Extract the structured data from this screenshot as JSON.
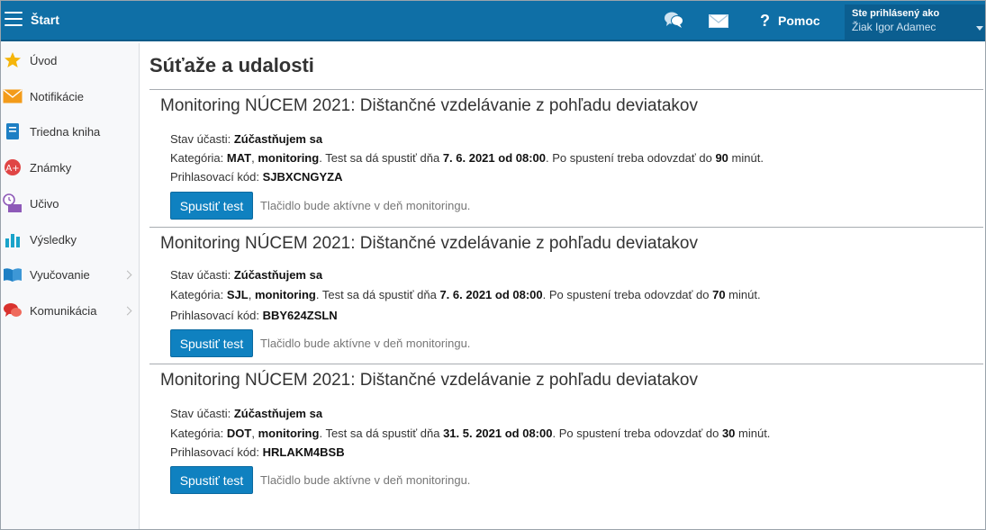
{
  "header": {
    "brand": "Štart",
    "help_label": "Pomoc",
    "help_symbol": "?",
    "user_top": "Ste prihlásený ako",
    "user_name": "Žiak Igor Adamec",
    "bar_color": "#0f6fa6"
  },
  "sidebar": {
    "items": [
      {
        "label": "Úvod",
        "icon": "star-icon",
        "color": "#f5b50a",
        "has_submenu": false
      },
      {
        "label": "Notifikácie",
        "icon": "envelope-icon",
        "color": "#f39b1a",
        "has_submenu": false
      },
      {
        "label": "Triedna kniha",
        "icon": "book-icon",
        "color": "#1e7fc4",
        "has_submenu": false
      },
      {
        "label": "Známky",
        "icon": "grade-icon",
        "color": "#e04545",
        "has_submenu": false
      },
      {
        "label": "Učivo",
        "icon": "clock-book-icon",
        "color": "#8e5ab8",
        "has_submenu": false
      },
      {
        "label": "Výsledky",
        "icon": "bar-chart-icon",
        "color": "#1aa3c9",
        "has_submenu": false
      },
      {
        "label": "Vyučovanie",
        "icon": "open-book-icon",
        "color": "#1e7fc4",
        "has_submenu": true
      },
      {
        "label": "Komunikácia",
        "icon": "chat-bubbles-icon",
        "color": "#d9322e",
        "has_submenu": true
      }
    ]
  },
  "main": {
    "page_title": "Súťaže a udalosti",
    "events": [
      {
        "title": "Monitoring NÚCEM 2021: Dištančné vzdelávanie z pohľadu deviatakov",
        "status_label": "Stav účasti: ",
        "status_value": "Zúčastňujem sa",
        "cat_label": "Kategória: ",
        "cat_subject": "MAT",
        "cat_sep": ", ",
        "cat_type": "monitoring",
        "cat_text1": ". Test sa dá spustiť dňa ",
        "cat_date": "7. 6. 2021 od 08:00",
        "cat_text2": ". Po spustení treba odovzdať do ",
        "cat_minutes": "90",
        "cat_text3": " minút.",
        "code_label": "Prihlasovací kód: ",
        "code_value": "SJBXCNGYZA",
        "button_label": "Spustiť test",
        "note": "Tlačidlo bude aktívne v deň monitoringu."
      },
      {
        "title": "Monitoring NÚCEM 2021: Dištančné vzdelávanie z pohľadu deviatakov",
        "status_label": "Stav účasti: ",
        "status_value": "Zúčastňujem sa",
        "cat_label": "Kategória: ",
        "cat_subject": "SJL",
        "cat_sep": ", ",
        "cat_type": "monitoring",
        "cat_text1": ". Test sa dá spustiť dňa ",
        "cat_date": "7. 6. 2021 od 08:00",
        "cat_text2": ". Po spustení treba odovzdať do ",
        "cat_minutes": "70",
        "cat_text3": " minút.",
        "code_label": "Prihlasovací kód: ",
        "code_value": "BBY624ZSLN",
        "button_label": "Spustiť test",
        "note": "Tlačidlo bude aktívne v deň monitoringu."
      },
      {
        "title": "Monitoring NÚCEM 2021: Dištančné vzdelávanie z pohľadu deviatakov",
        "status_label": "Stav účasti: ",
        "status_value": "Zúčastňujem sa",
        "cat_label": "Kategória: ",
        "cat_subject": "DOT",
        "cat_sep": ", ",
        "cat_type": "monitoring",
        "cat_text1": ". Test sa dá spustiť dňa ",
        "cat_date": "31. 5. 2021 od 08:00",
        "cat_text2": ". Po spustení treba odovzdať do ",
        "cat_minutes": "30",
        "cat_text3": " minút.",
        "code_label": "Prihlasovací kód: ",
        "code_value": "HRLAKM4BSB",
        "button_label": "Spustiť test",
        "note": "Tlačidlo bude aktívne v deň monitoringu."
      }
    ]
  }
}
